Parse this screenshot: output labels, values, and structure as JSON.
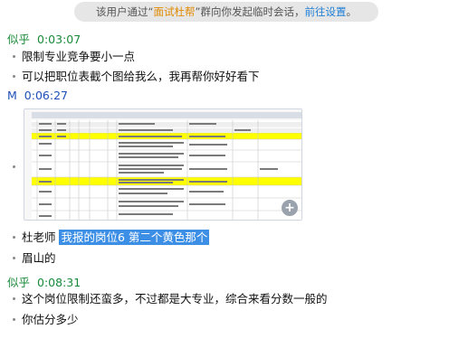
{
  "notice": {
    "prefix": "该用户通过“",
    "group": "面试杜帮",
    "middle": "”群向你发起临时会话，",
    "link": "前往设置",
    "suffix": "。"
  },
  "messages": [
    {
      "sender": "似乎",
      "time": "0:03:07",
      "lines": [
        "限制专业竞争要小一点",
        "可以把职位表截个图给我么，我再帮你好好看下"
      ]
    },
    {
      "sender": "M",
      "time": "0:06:27"
    },
    {
      "lines_after_image": [
        "杜老师 ",
        "我报的岗位6 第二个黄色那个",
        "眉山的"
      ]
    },
    {
      "sender": "似乎",
      "time": "0:08:31",
      "lines": [
        "这个岗位限制还蛮多，不过都是大专业，综合来看分数一般的",
        "你估分多少"
      ]
    }
  ],
  "image": {
    "zoom_icon": "zoom-in-icon"
  },
  "colors": {
    "green_sender": "#1a8a3a",
    "blue_sender": "#1f4fb8",
    "link": "#1f7fd6",
    "group": "#e08a00",
    "selection": "#3d8fe6",
    "highlight_row": "#ffff00"
  }
}
